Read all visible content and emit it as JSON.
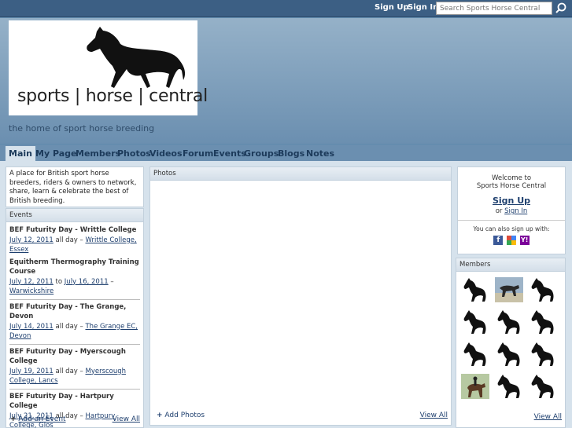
{
  "topbar": {
    "signup": "Sign Up",
    "signin": "Sign In",
    "search_placeholder": "Search Sports Horse Central"
  },
  "header": {
    "logo_text": "sports | horse | central",
    "tagline": "the home of sport horse breeding"
  },
  "nav": {
    "tabs": [
      "Main",
      "My Page",
      "Members",
      "Photos",
      "Videos",
      "Forum",
      "Events",
      "Groups",
      "Blogs",
      "Notes"
    ]
  },
  "intro": {
    "text": "A place for British sport horse breeders, riders & owners to network, share, learn & celebrate the best of British breeding."
  },
  "events": {
    "title": "Events",
    "items": [
      {
        "title": "BEF Futurity Day - Writtle College",
        "date": "July 12, 2011",
        "time": "all day –",
        "place": "Writtle College, Essex"
      },
      {
        "title": "Equitherm Thermography Training Course",
        "date": "July 12, 2011",
        "to": "to",
        "date2": "July 16, 2011",
        "dash": "–",
        "place": "Warwickshire"
      },
      {
        "title": "BEF Futurity Day - The Grange, Devon",
        "date": "July 14, 2011",
        "time": "all day –",
        "place": "The Grange EC, Devon"
      },
      {
        "title": "BEF Futurity Day - Myerscough College",
        "date": "July 19, 2011",
        "time": "all day –",
        "place": "Myerscough College, Lancs"
      },
      {
        "title": "BEF Futurity Day - Hartpury College",
        "date": "July 21, 2011",
        "time": "all day –",
        "place": "Hartpury College, Glos"
      }
    ],
    "add_link": "Add an Event",
    "view_all": "View All"
  },
  "photos": {
    "title": "Photos",
    "add_link": "Add Photos",
    "view_all": "View All"
  },
  "welcome": {
    "line1": "Welcome to",
    "line2": "Sports Horse Central",
    "signup": "Sign Up",
    "or": "or",
    "signin": "Sign In",
    "also": "You can also sign up with:",
    "social_icons": [
      "facebook-icon",
      "google-icon",
      "yahoo-icon"
    ]
  },
  "members": {
    "title": "Members",
    "view_all": "View All"
  }
}
